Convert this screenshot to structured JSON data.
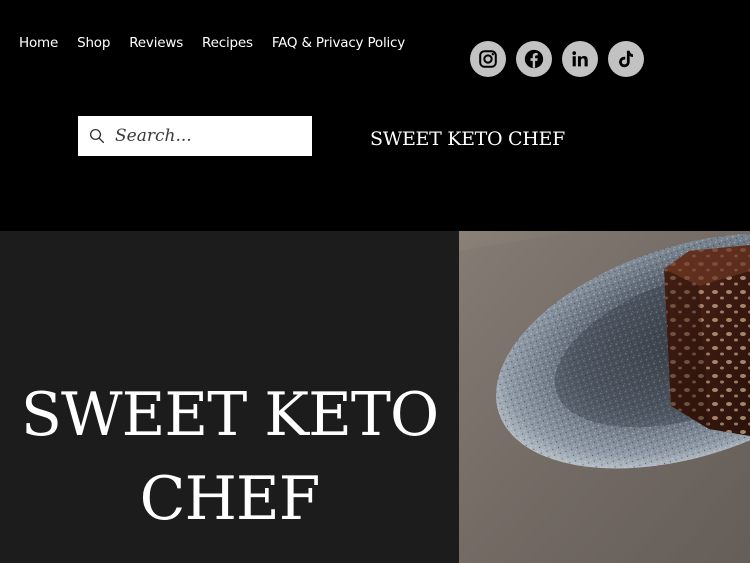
{
  "nav": {
    "items": [
      {
        "label": "Home"
      },
      {
        "label": "Shop"
      },
      {
        "label": "Reviews"
      },
      {
        "label": "Recipes"
      },
      {
        "label": "FAQ & Privacy Policy"
      }
    ]
  },
  "social": {
    "icons": [
      "instagram-icon",
      "facebook-icon",
      "linkedin-icon",
      "tiktok-icon"
    ],
    "icon_bg": "#c2c2c2",
    "icon_fg": "#000000"
  },
  "search": {
    "placeholder": "Search..."
  },
  "header": {
    "brand": "SWEET KETO CHEF"
  },
  "hero": {
    "title_line1": "SWEET KETO",
    "title_line2": "CHEF",
    "image_description_icon": "food-photo"
  },
  "colors": {
    "header_bg": "#000000",
    "hero_bg": "#1c1c1c",
    "text": "#ffffff"
  }
}
